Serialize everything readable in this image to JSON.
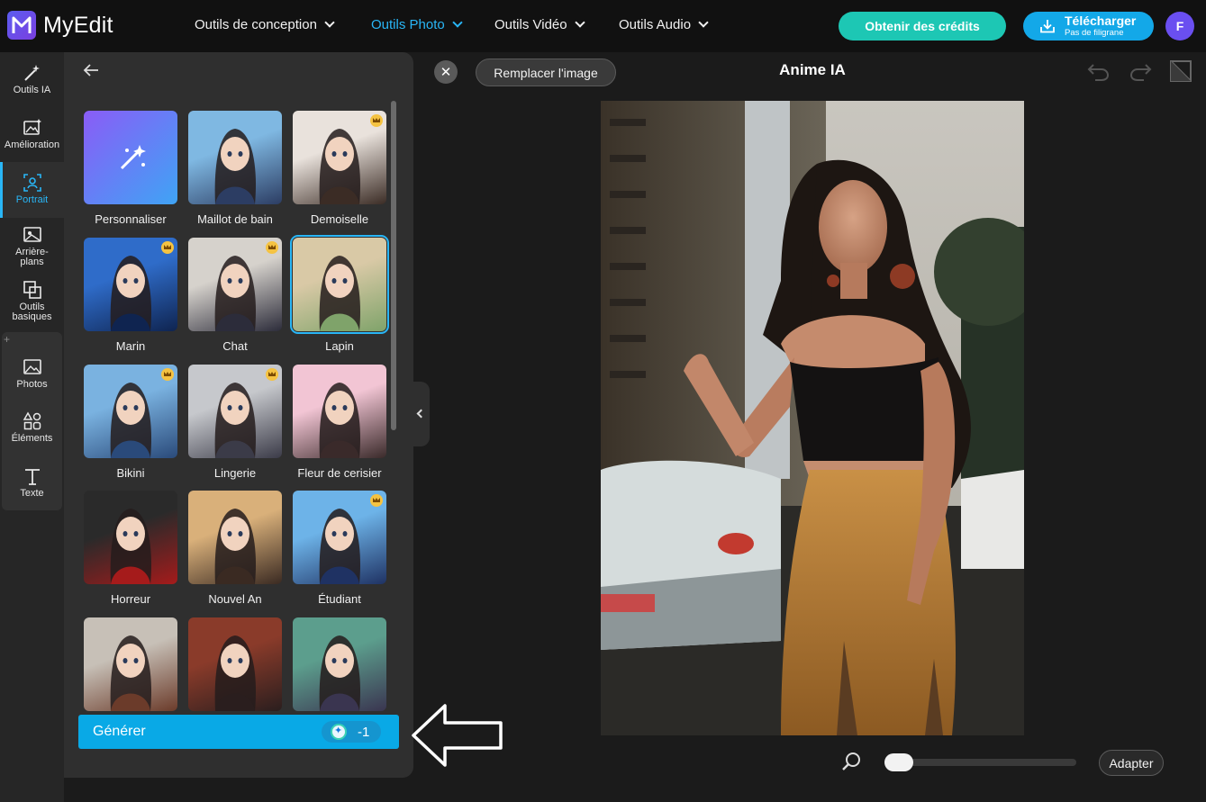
{
  "app": {
    "name": "MyEdit",
    "logo_letter": "M"
  },
  "nav": [
    {
      "label": "Outils de conception",
      "active": false
    },
    {
      "label": "Outils Photo",
      "active": true
    },
    {
      "label": "Outils Vidéo",
      "active": false
    },
    {
      "label": "Outils Audio",
      "active": false
    }
  ],
  "header": {
    "credits_label": "Obtenir des crédits",
    "download_label": "Télécharger",
    "download_sub": "Pas de filigrane",
    "avatar_initial": "F"
  },
  "colors": {
    "accent": "#29b6f6",
    "credits": "#1dc7b4",
    "download": "#13a8e8",
    "avatar": "#6a4ff0"
  },
  "sidebar": {
    "items": [
      {
        "label": "Outils IA",
        "icon": "magic-wand-icon"
      },
      {
        "label": "Amélioration",
        "icon": "image-enhance-icon"
      },
      {
        "label": "Portrait",
        "icon": "portrait-icon",
        "active": true
      },
      {
        "label": "Arrière-plans",
        "icon": "background-icon"
      },
      {
        "label": "Outils basiques",
        "icon": "crop-icon"
      },
      {
        "label": "Photos",
        "icon": "photo-icon"
      },
      {
        "label": "Éléments",
        "icon": "elements-icon"
      },
      {
        "label": "Texte",
        "icon": "text-icon"
      }
    ]
  },
  "styles": [
    {
      "label": "Personnaliser",
      "premium": false
    },
    {
      "label": "Maillot de bain",
      "premium": false
    },
    {
      "label": "Demoiselle",
      "premium": true
    },
    {
      "label": "Marin",
      "premium": true
    },
    {
      "label": "Chat",
      "premium": true
    },
    {
      "label": "Lapin",
      "premium": false,
      "selected": true
    },
    {
      "label": "Bikini",
      "premium": true
    },
    {
      "label": "Lingerie",
      "premium": true
    },
    {
      "label": "Fleur de cerisier",
      "premium": false
    },
    {
      "label": "Horreur",
      "premium": false
    },
    {
      "label": "Nouvel An",
      "premium": false
    },
    {
      "label": "Étudiant",
      "premium": true
    },
    {
      "label": "",
      "premium": false
    },
    {
      "label": "",
      "premium": false
    },
    {
      "label": "",
      "premium": false
    }
  ],
  "generate": {
    "label": "Générer",
    "cost": "-1"
  },
  "canvas": {
    "close_symbol": "✕",
    "replace_label": "Remplacer l'image",
    "title": "Anime IA",
    "fit_label": "Adapter",
    "zoom_level": 0.0
  }
}
